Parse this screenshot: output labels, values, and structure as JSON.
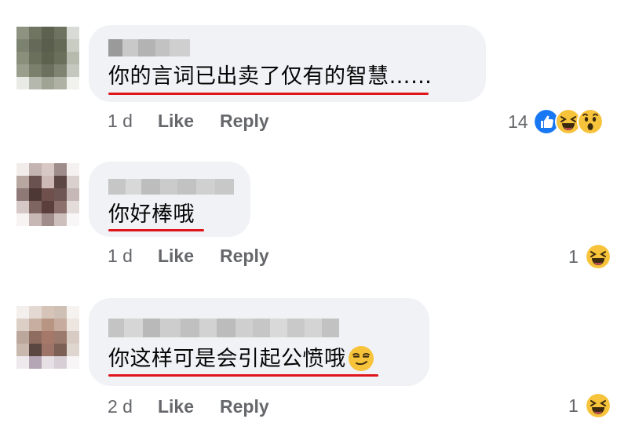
{
  "comments": [
    {
      "text": "你的言词已出卖了仅有的智慧……",
      "time": "1 d",
      "like_label": "Like",
      "reply_label": "Reply",
      "reaction_count": "14",
      "reactions": [
        "like-icon",
        "laugh-icon",
        "wow-icon"
      ],
      "avatar_colors": [
        "#8e9281",
        "#6f7560",
        "#5c6150",
        "#6d7360",
        "#d9dcd6",
        "#7c8270",
        "#656a58",
        "#5a5f4d",
        "#646a56",
        "#c9ccc3",
        "#8a8f7c",
        "#6b705d",
        "#5d624f",
        "#6a6f5c",
        "#b7bbae",
        "#9a9e8d",
        "#7b806d",
        "#6c705e",
        "#7f8472",
        "#c5c8be",
        "#e9eae6",
        "#b5b8ac",
        "#9fa393",
        "#aeb1a4",
        "#f1f1ee"
      ]
    },
    {
      "text": "你好棒哦",
      "time": "1 d",
      "like_label": "Like",
      "reply_label": "Reply",
      "reaction_count": "1",
      "reactions": [
        "laugh-icon"
      ],
      "avatar_colors": [
        "#f2ecea",
        "#c3b4b1",
        "#d8c8c4",
        "#9d8c89",
        "#f4f1f0",
        "#b8a6a1",
        "#6a5250",
        "#cdb9b5",
        "#5c4744",
        "#dad0ce",
        "#8e7976",
        "#4e3836",
        "#70504c",
        "#6e5654",
        "#c5b8b6",
        "#d6c8c6",
        "#7f6562",
        "#5a3f3c",
        "#8c706d",
        "#e4dcdb",
        "#f6f3f2",
        "#c8b8b5",
        "#a08c89",
        "#cdbfbc",
        "#f8f6f6"
      ]
    },
    {
      "text": "你这样可是会引起公愤哦",
      "time": "2 d",
      "like_label": "Like",
      "reply_label": "Reply",
      "reaction_count": "1",
      "reactions": [
        "laugh-icon"
      ],
      "avatar_colors": [
        "#f3efec",
        "#e3d8d2",
        "#d6c4b9",
        "#cfc0b6",
        "#f5f2ef",
        "#dccfc6",
        "#c8aea1",
        "#b89483",
        "#c7ab9e",
        "#ece5e0",
        "#bca79c",
        "#8e6d60",
        "#a5786a",
        "#9a7a6d",
        "#d8cbc3",
        "#c9b8ae",
        "#5a4741",
        "#9e7468",
        "#7c5f55",
        "#e0d6d0",
        "#eee9ed",
        "#b4a6b4",
        "#e6dfe3",
        "#d8cfd6",
        "#f7f5f6"
      ]
    }
  ],
  "colors": {
    "bubble_bg": "#f0f2f5",
    "text": "#050505",
    "meta": "#65676b",
    "underline": "#e0141b",
    "like_blue": "#1877f2",
    "emoji_yellow": "#f7c33b"
  }
}
